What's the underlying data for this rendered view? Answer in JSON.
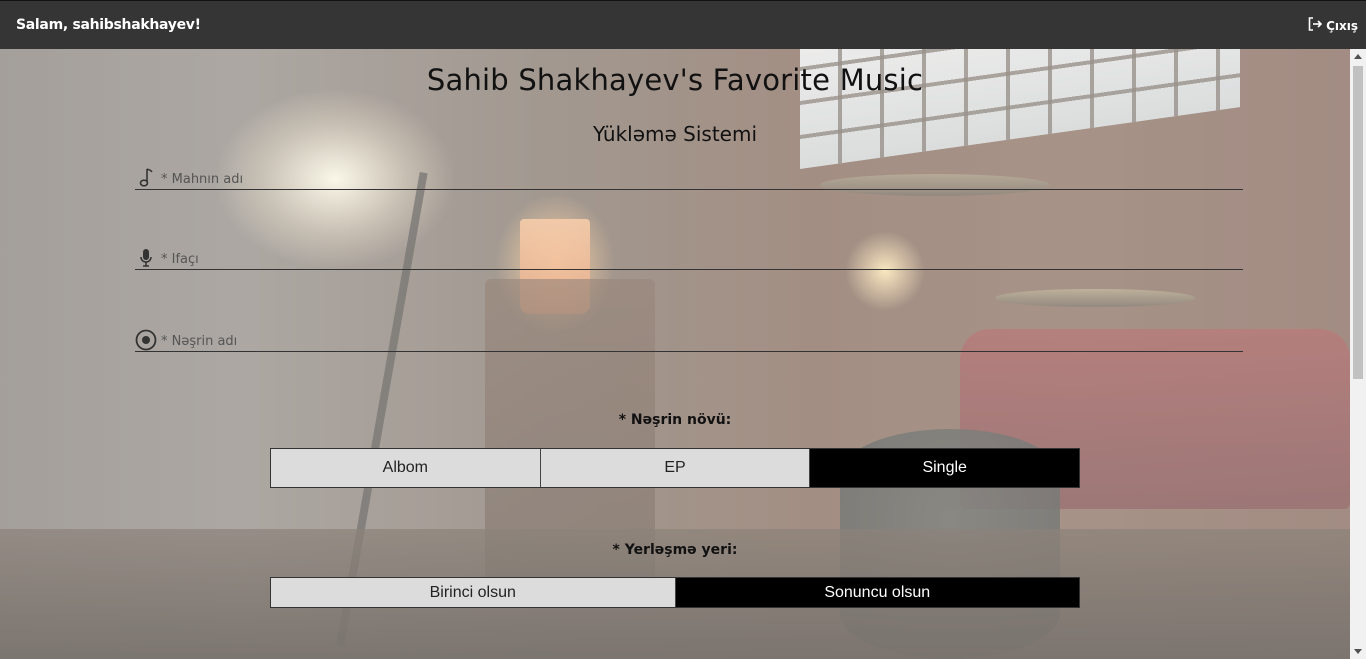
{
  "header": {
    "greeting": "Salam, sahibshakhayev!",
    "logout_label": "Çıxış",
    "logout_icon": "logout-icon"
  },
  "main": {
    "title": "Sahib Shakhayev's Favorite Music",
    "subtitle": "Yükləmə Sistemi",
    "fields": {
      "song": {
        "placeholder": "* Mahnın adı",
        "value": "",
        "icon": "music-note-icon"
      },
      "artist": {
        "placeholder": "* İfaçı",
        "value": "",
        "icon": "microphone-icon"
      },
      "release": {
        "placeholder": "* Nəşrin adı",
        "value": "",
        "icon": "disc-icon"
      }
    },
    "release_type": {
      "label": "* Nəşrin növü:",
      "options": [
        "Albom",
        "EP",
        "Single"
      ],
      "selected": "Single"
    },
    "placement": {
      "label": "* Yerləşmə yeri:",
      "options": [
        "Birinci olsun",
        "Sonuncu olsun"
      ],
      "selected": "Sonuncu olsun"
    }
  },
  "colors": {
    "topbar": "#353535",
    "selected_bg": "#000000",
    "unselected_bg": "#dcdcdc"
  }
}
